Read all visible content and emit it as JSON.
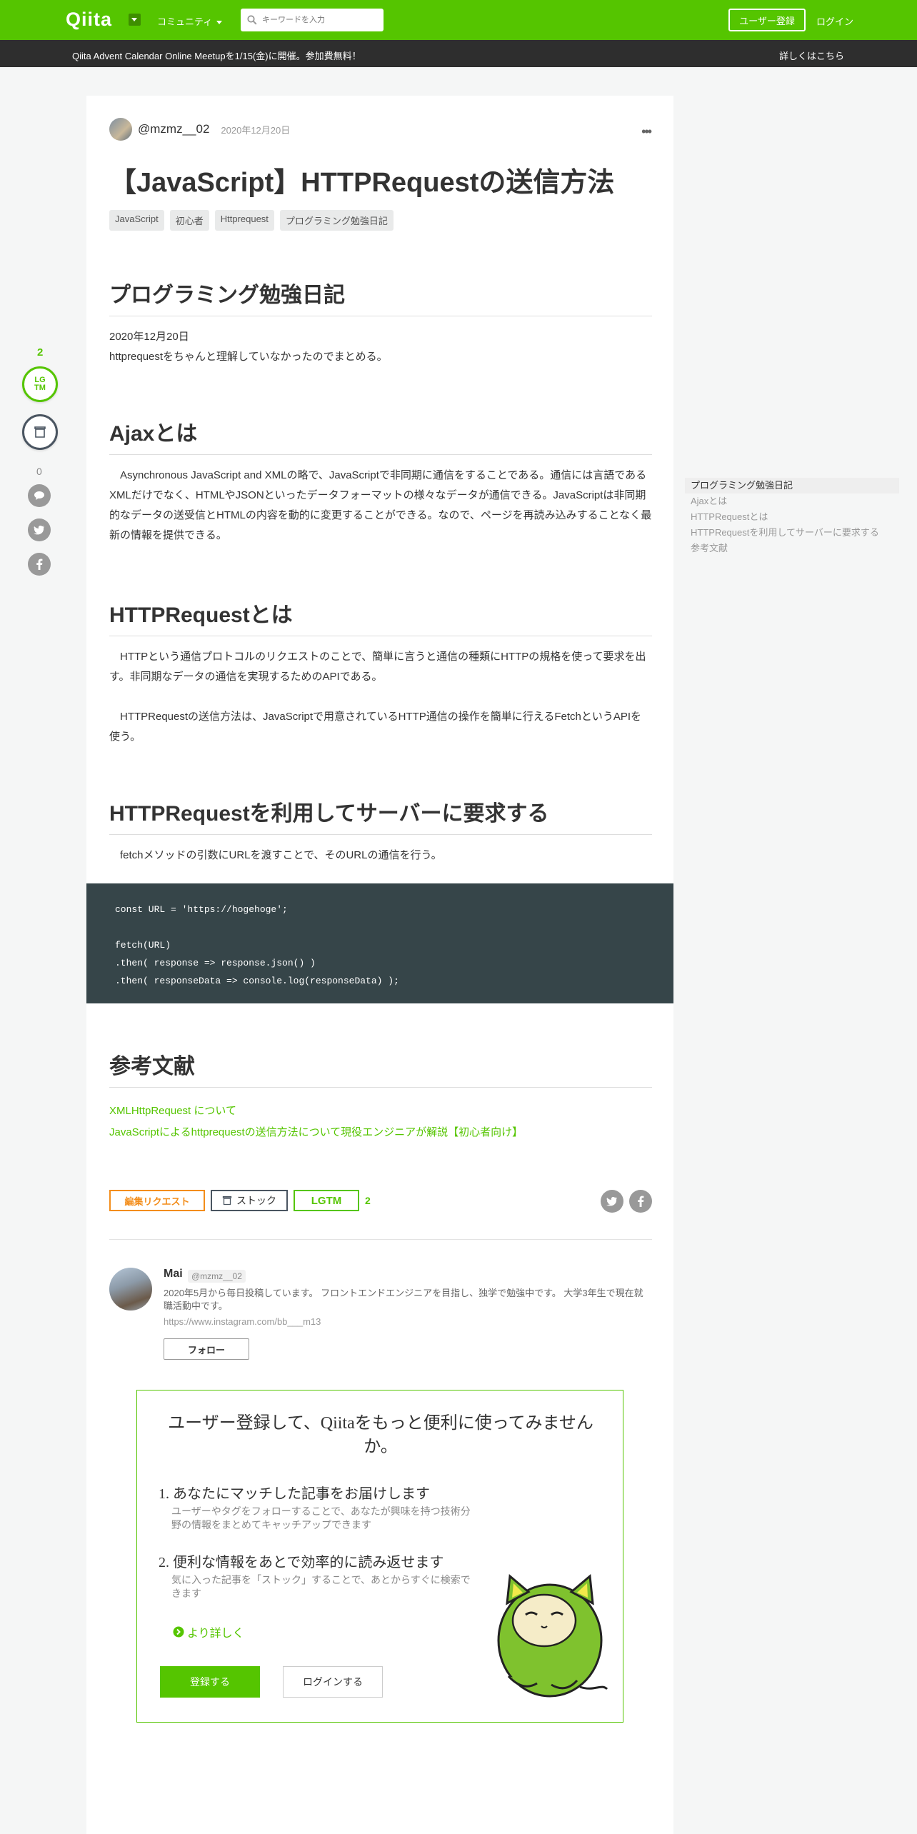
{
  "header": {
    "logo": "Qiita",
    "community": "コミュニティ",
    "search_placeholder": "キーワードを入力",
    "signup": "ユーザー登録",
    "login": "ログイン"
  },
  "banner": {
    "text": "Qiita Advent Calendar Online Meetupを1/15(金)に開催。参加費無料！",
    "link": "詳しくはこちら"
  },
  "side": {
    "lgtm_count": "2",
    "lgtm_label_1": "LG",
    "lgtm_label_2": "TM",
    "comment_count": "0"
  },
  "article": {
    "author": "@mzmz__02",
    "date": "2020年12月20日",
    "title": "【JavaScript】HTTPRequestの送信方法",
    "tags": [
      "JavaScript",
      "初心者",
      "Httprequest",
      "プログラミング勉強日記"
    ],
    "sections": [
      {
        "heading": "プログラミング勉強日記",
        "paragraphs": [
          "2020年12月20日",
          "httprequestをちゃんと理解していなかったのでまとめる。"
        ]
      },
      {
        "heading": "Ajaxとは",
        "paragraphs": [
          "　Asynchronous JavaScript and XMLの略で、JavaScriptで非同期に通信をすることである。通信には言語であるXMLだけでなく、HTMLやJSONといったデータフォーマットの様々なデータが通信できる。JavaScriptは非同期的なデータの送受信とHTMLの内容を動的に変更することができる。なので、ページを再読み込みすることなく最新の情報を提供できる。"
        ]
      },
      {
        "heading": "HTTPRequestとは",
        "paragraphs": [
          "　HTTPという通信プロトコルのリクエストのことで、簡単に言うと通信の種類にHTTPの規格を使って要求を出す。非同期なデータの通信を実現するためのAPIである。",
          "　HTTPRequestの送信方法は、JavaScriptで用意されているHTTP通信の操作を簡単に行えるFetchというAPIを使う。"
        ]
      },
      {
        "heading": "HTTPRequestを利用してサーバーに要求する",
        "paragraphs": [
          "　fetchメソッドの引数にURLを渡すことで、そのURLの通信を行う。"
        ]
      },
      {
        "heading": "参考文献",
        "paragraphs": []
      }
    ],
    "code": "const URL = 'https://hogehoge';\n\nfetch(URL)\n.then( response => response.json() )\n.then( responseData => console.log(responseData) );",
    "references": [
      "XMLHttpRequest について",
      "JavaScriptによるhttprequestの送信方法について現役エンジニアが解説【初心者向け】"
    ]
  },
  "actions": {
    "edit_request": "編集リクエスト",
    "stock": "ストック",
    "lgtm": "LGTM",
    "lgtm_count": "2"
  },
  "profile": {
    "name": "Mai",
    "id": "@mzmz__02",
    "bio": "2020年5月から毎日投稿しています。 フロントエンドエンジニアを目指し、独学で勉強中です。 大学3年生で現在就職活動中です。",
    "url": "https://www.instagram.com/bb___m13",
    "follow": "フォロー"
  },
  "signup_box": {
    "title": "ユーザー登録して、Qiitaをもっと便利に使ってみませんか。",
    "benefits": [
      {
        "title": "1. あなたにマッチした記事をお届けします",
        "desc": "ユーザーやタグをフォローすることで、あなたが興味を持つ技術分野の情報をまとめてキャッチアップできます"
      },
      {
        "title": "2. 便利な情報をあとで効率的に読み返せます",
        "desc": "気に入った記事を「ストック」することで、あとからすぐに検索できます"
      }
    ],
    "more": "より詳しく",
    "register": "登録する",
    "login": "ログインする"
  },
  "toc": [
    "プログラミング勉強日記",
    "Ajaxとは",
    "HTTPRequestとは",
    "HTTPRequestを利用してサーバーに要求する",
    "参考文献"
  ],
  "colors": {
    "brand_green": "#55c500",
    "banner_bg": "#2e2e2e",
    "code_bg": "#364549",
    "edit_orange": "#f38d1a"
  }
}
